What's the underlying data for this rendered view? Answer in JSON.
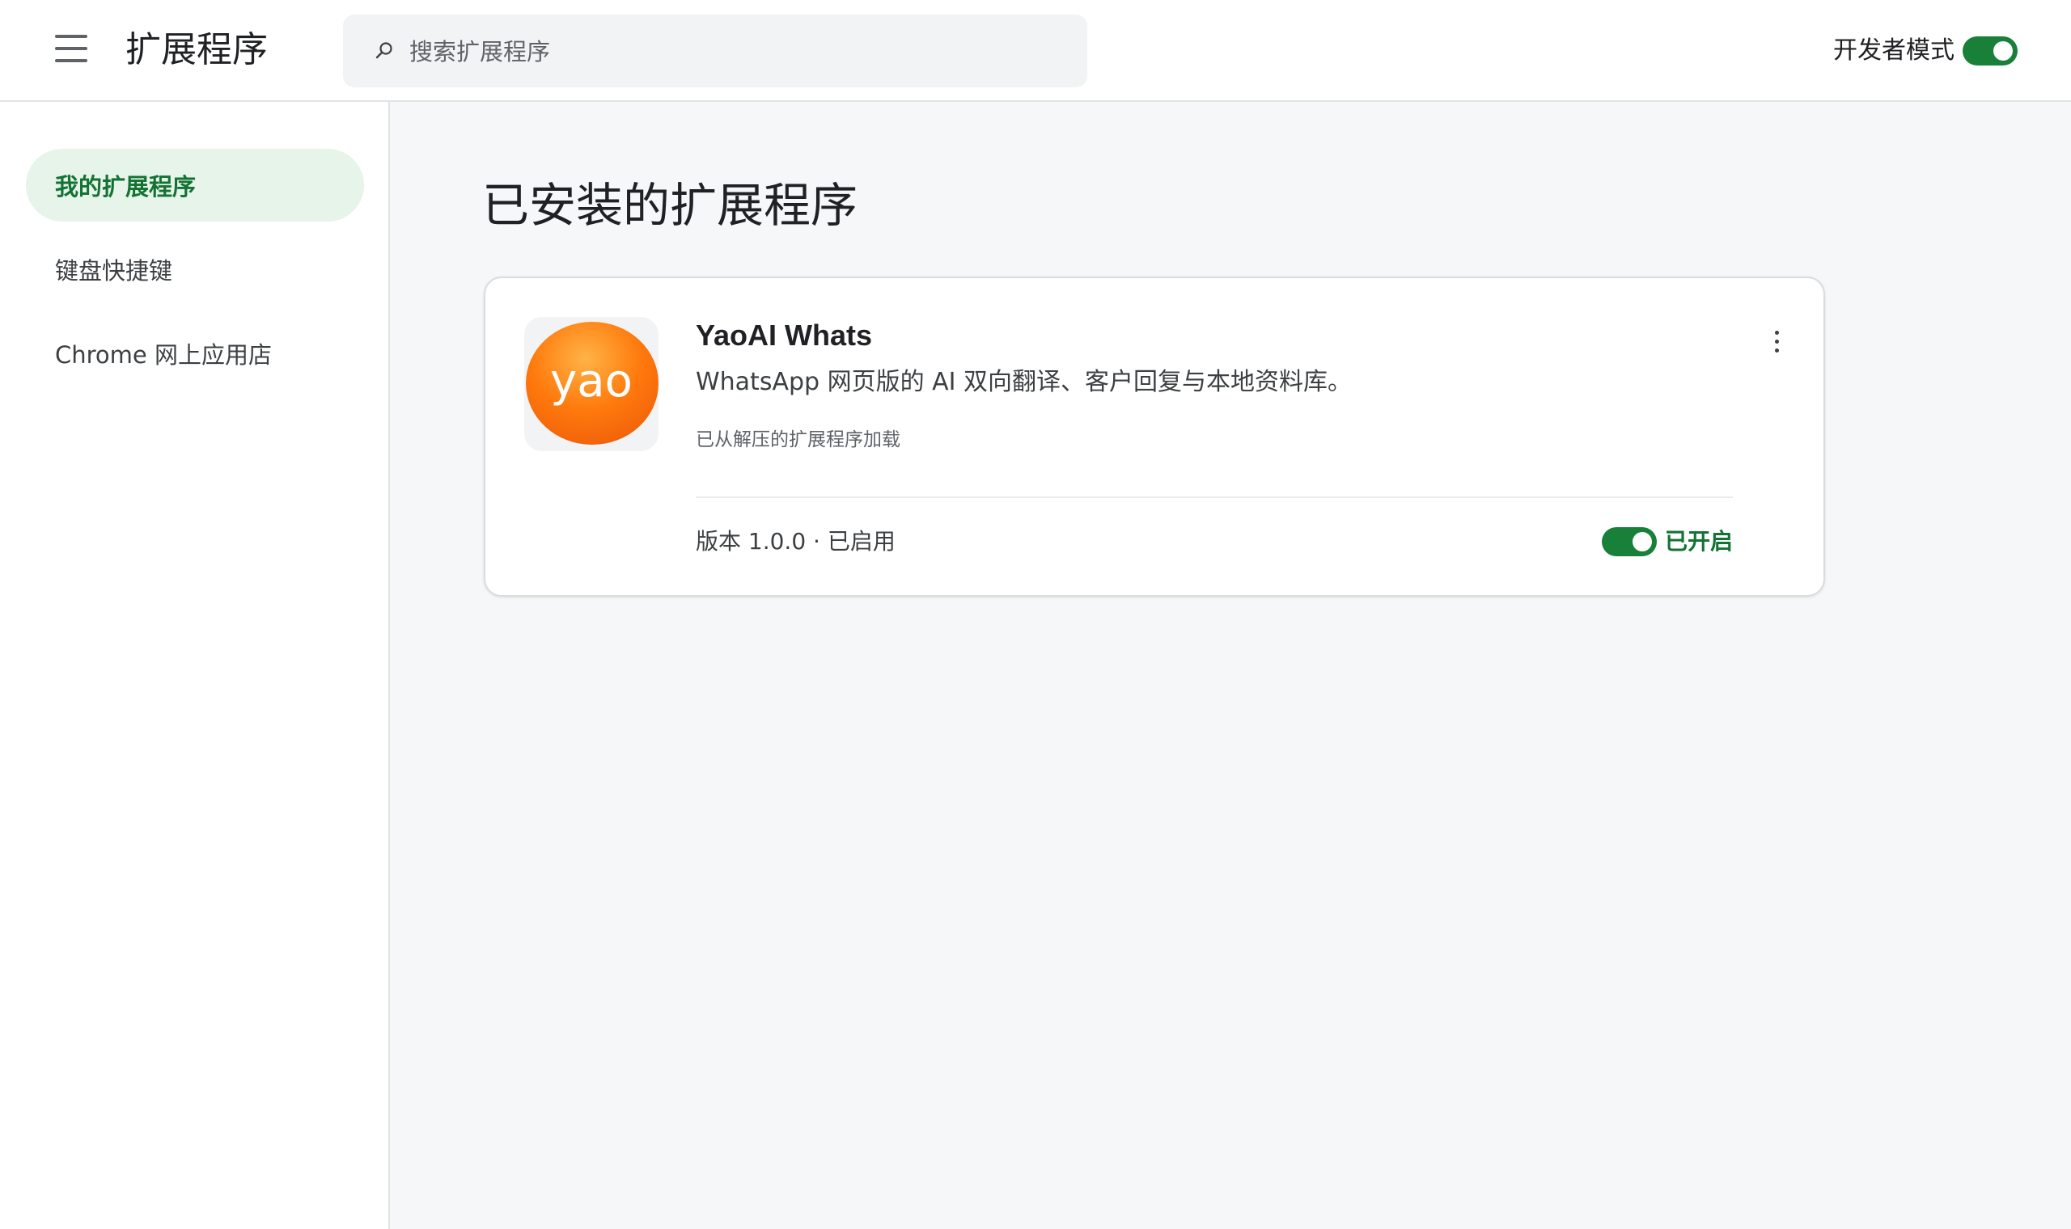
{
  "header": {
    "title": "扩展程序",
    "search_placeholder": "搜索扩展程序",
    "search_value": "",
    "developer_mode_label": "开发者模式",
    "developer_mode_on": true
  },
  "sidebar": {
    "items": [
      {
        "label": "我的扩展程序",
        "active": true
      },
      {
        "label": "键盘快捷键",
        "active": false
      },
      {
        "label": "Chrome 网上应用店",
        "active": false
      }
    ]
  },
  "main": {
    "title": "已安装的扩展程序",
    "extensions": [
      {
        "icon_text": "yao",
        "name": "YaoAI Whats",
        "description": "WhatsApp 网页版的 AI 双向翻译、客户回复与本地资料库。",
        "source": "已从解压的扩展程序加载",
        "meta": "版本 1.0.0 · 已启用",
        "enabled": true,
        "toggle_label": "已开启"
      }
    ]
  },
  "icons": {
    "menu": "hamburger-menu-icon",
    "search": "search-icon",
    "more": "more-vertical-icon"
  },
  "colors": {
    "accent_green": "#188038",
    "active_text_green": "#137333",
    "active_nav_bg": "#e6f4ea",
    "main_bg": "#f6f7f9",
    "icon_orange": "#ff7a0d"
  }
}
